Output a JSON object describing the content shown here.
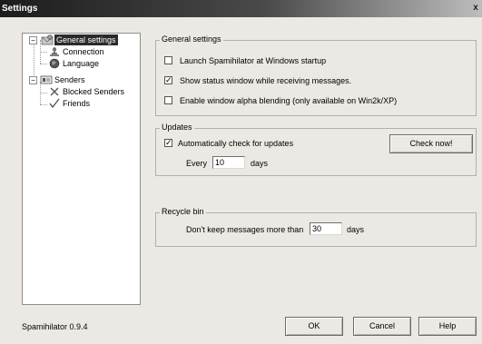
{
  "window": {
    "title": "Settings",
    "close_glyph": "x"
  },
  "tree": {
    "items": [
      {
        "label": "General settings",
        "icon": "general-settings-icon",
        "expander": "−"
      },
      {
        "label": "Connection",
        "icon": "connection-icon"
      },
      {
        "label": "Language",
        "icon": "language-globe-icon"
      },
      {
        "label": "Senders",
        "icon": "senders-icon",
        "expander": "−"
      },
      {
        "label": "Blocked Senders",
        "icon": "blocked-x-icon"
      },
      {
        "label": "Friends",
        "icon": "friends-check-icon"
      }
    ]
  },
  "general": {
    "title": "General settings",
    "options": [
      {
        "label": "Launch Spamihilator at Windows startup",
        "checked": false
      },
      {
        "label": "Show status window while receiving messages.",
        "checked": true
      },
      {
        "label": "Enable window alpha blending (only available on Win2k/XP)",
        "checked": false
      }
    ]
  },
  "updates": {
    "title": "Updates",
    "auto_check_label": "Automatically check for updates",
    "auto_check_checked": true,
    "check_now_label": "Check now!",
    "every_label": "Every",
    "every_value": "10",
    "days_label": "days"
  },
  "recycle": {
    "title": "Recycle bin",
    "keep_label": "Don't keep messages more than",
    "keep_value": "30",
    "days_label": "days"
  },
  "footer": {
    "version": "Spamihilator 0.9.4",
    "ok_label": "OK",
    "cancel_label": "Cancel",
    "help_label": "Help"
  },
  "glyphs": {
    "check": "✓"
  }
}
